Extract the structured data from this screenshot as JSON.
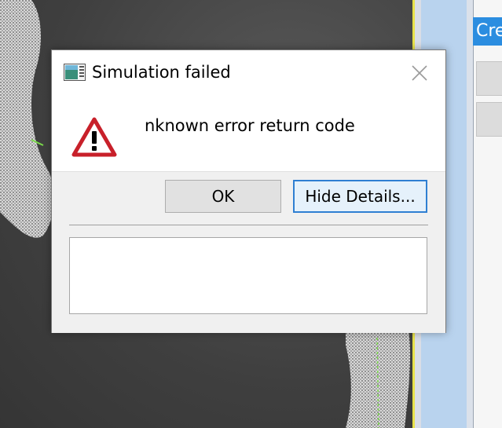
{
  "dialog": {
    "title": "Simulation failed",
    "message": "nknown error return code",
    "icon": "warning-icon",
    "buttons": {
      "ok_label": "OK",
      "details_label": "Hide Details..."
    },
    "details_text": ""
  },
  "side_panel": {
    "create_tab_label": "Cre"
  },
  "colors": {
    "accent": "#2b8de0",
    "warning_red": "#c8202a",
    "viewport_edge": "#e8e24a"
  }
}
